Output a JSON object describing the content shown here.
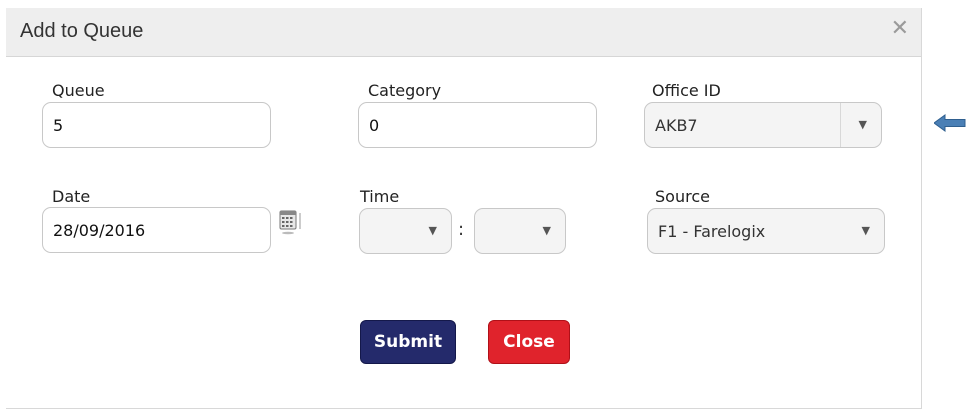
{
  "dialog": {
    "title": "Add to Queue",
    "close_icon": "close-icon"
  },
  "form": {
    "queue": {
      "label": "Queue",
      "value": "5"
    },
    "category": {
      "label": "Category",
      "value": "0"
    },
    "office_id": {
      "label": "Office ID",
      "selected": "AKB7"
    },
    "date": {
      "label": "Date",
      "value": "28/09/2016",
      "icon": "calendar-icon"
    },
    "time": {
      "label": "Time",
      "hour": "",
      "minute": "",
      "separator": ":"
    },
    "source": {
      "label": "Source",
      "selected": "F1 - Farelogix"
    }
  },
  "buttons": {
    "submit_label": "Submit",
    "close_label": "Close"
  },
  "colors": {
    "submit": "#242a6b",
    "close": "#e0232c",
    "arrow": "#4a7fb5"
  },
  "annotation_icon": "left-arrow-icon"
}
